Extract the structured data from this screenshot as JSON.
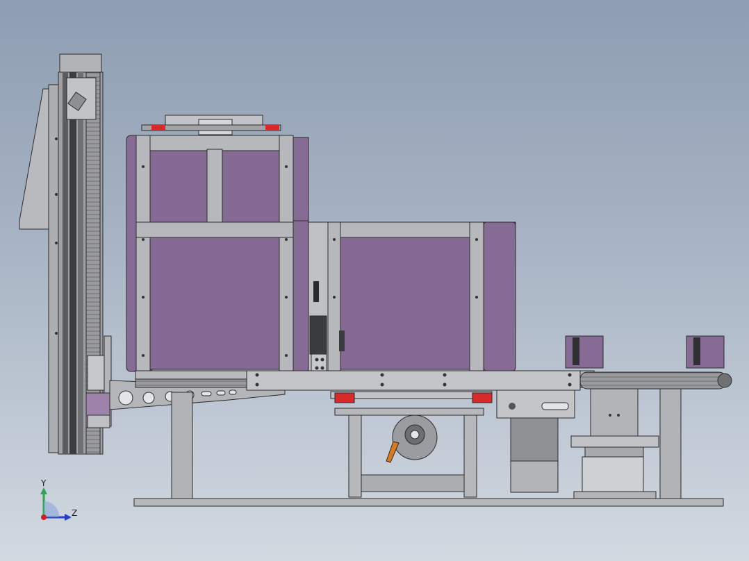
{
  "triad": {
    "y_label": "Y",
    "z_label": "Z",
    "colors": {
      "y": "#2ea44f",
      "z": "#1f3fd6",
      "x": "#d02020"
    }
  },
  "colors": {
    "frame": "#b4b5b8",
    "frame_dark": "#8e9093",
    "panel": "#856b93",
    "panel_light": "#9a80a6",
    "outline": "#2b2b2b",
    "accent_red": "#d82a2a",
    "accent_orange": "#d97a1e"
  }
}
